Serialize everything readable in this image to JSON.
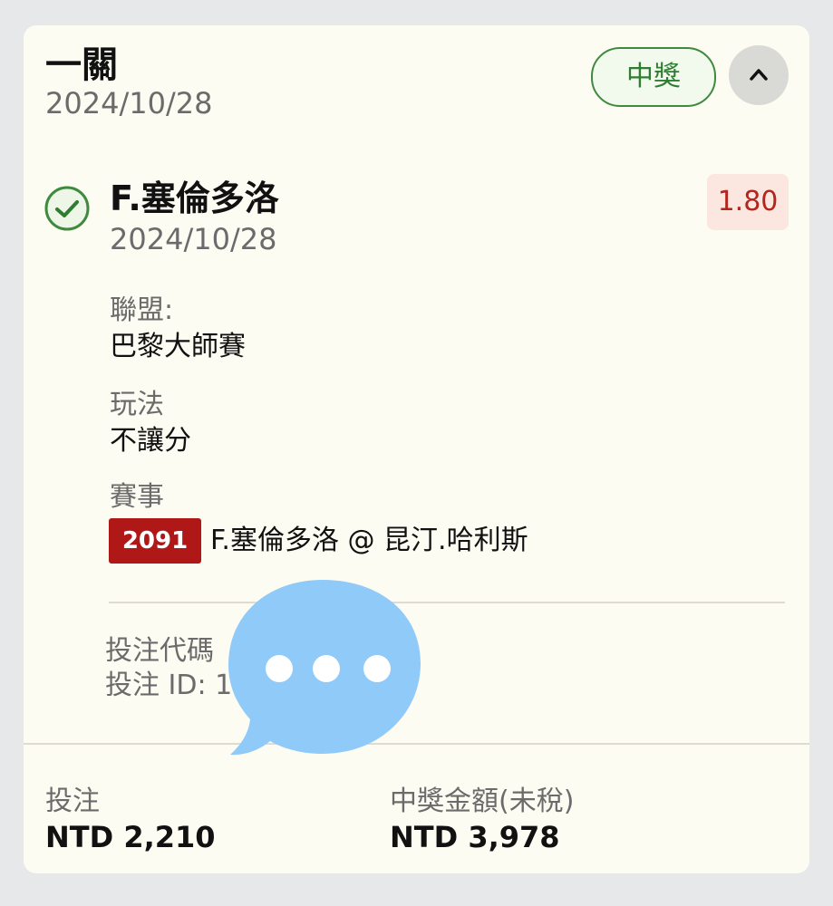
{
  "bet": {
    "title": "一關",
    "date": "2024/10/28",
    "status_badge": "中獎"
  },
  "selection": {
    "name": "F.塞倫多洛",
    "date": "2024/10/28",
    "odds": "1.80",
    "league_label": "聯盟:",
    "league_value": "巴黎大師賽",
    "bet_type_label": "玩法",
    "bet_type_value": "不讓分",
    "event_label": "賽事",
    "event_code": "2091",
    "event_name": "F.塞倫多洛 @ 昆汀.哈利斯"
  },
  "ticket": {
    "code_label": "投注代碼",
    "id_label": "投注 ID: 1"
  },
  "footer": {
    "stake_label": "投注",
    "stake_value": "NTD 2,210",
    "payout_label": "中獎金額(未稅)",
    "payout_value": "NTD 3,978"
  },
  "colors": {
    "win_green": "#2f7d31",
    "odds_red": "#b3261e",
    "event_code_bg": "#b01717",
    "card_bg": "#fdfcf2",
    "overlay_blue": "#90caf9"
  },
  "icons": {
    "check": "check-circle-icon",
    "collapse": "chevron-up-icon",
    "overlay": "chat-bubble-icon"
  }
}
